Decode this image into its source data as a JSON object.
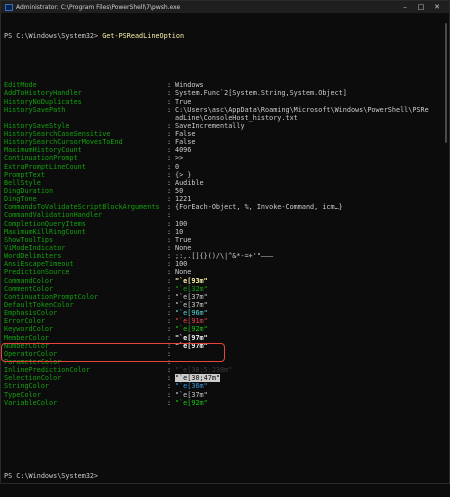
{
  "window": {
    "title": "Administrator: C:\\Program Files\\PowerShell\\7\\pwsh.exe",
    "controls": [
      "–",
      "□",
      "✕"
    ]
  },
  "console": {
    "prompt1": "PS C:\\Windows\\System32> ",
    "command": "Get-PSReadLineOption",
    "prompt2": "PS C:\\Windows\\System32>",
    "groups": [
      [
        {
          "key": "EditMode",
          "value": "Windows",
          "color": "#cccccc"
        },
        {
          "key": "AddToHistoryHandler",
          "value": "System.Func`2[System.String,System.Object]",
          "color": "#cccccc"
        },
        {
          "key": "HistoryNoDuplicates",
          "value": "True",
          "color": "#cccccc"
        },
        {
          "key": "HistorySavePath",
          "value": "C:\\Users\\asc\\AppData\\Roaming\\Microsoft\\Windows\\PowerShell\\PSRe",
          "color": "#cccccc"
        },
        {
          "key": "",
          "value": "adLine\\ConsoleHost_history.txt",
          "color": "#cccccc",
          "cont": true
        },
        {
          "key": "HistorySaveStyle",
          "value": "SaveIncrementally",
          "color": "#cccccc"
        },
        {
          "key": "HistorySearchCaseSensitive",
          "value": "False",
          "color": "#cccccc"
        },
        {
          "key": "HistorySearchCursorMovesToEnd",
          "value": "False",
          "color": "#cccccc"
        },
        {
          "key": "MaximumHistoryCount",
          "value": "4096",
          "color": "#cccccc"
        },
        {
          "key": "ContinuationPrompt",
          "value": ">>",
          "color": "#cccccc"
        },
        {
          "key": "ExtraPromptLineCount",
          "value": "0",
          "color": "#cccccc"
        },
        {
          "key": "PromptText",
          "value": "{> }",
          "color": "#cccccc"
        },
        {
          "key": "BellStyle",
          "value": "Audible",
          "color": "#cccccc"
        },
        {
          "key": "DingDuration",
          "value": "50",
          "color": "#cccccc"
        },
        {
          "key": "DingTone",
          "value": "1221",
          "color": "#cccccc"
        },
        {
          "key": "CommandsToValidateScriptBlockArguments",
          "value": "{ForEach-Object, %, Invoke-Command, icm…}",
          "color": "#cccccc"
        },
        {
          "key": "CommandValidationHandler",
          "value": "",
          "color": "#cccccc"
        },
        {
          "key": "CompletionQueryItems",
          "value": "100",
          "color": "#cccccc"
        },
        {
          "key": "MaximumKillRingCount",
          "value": "10",
          "color": "#cccccc"
        },
        {
          "key": "ShowToolTips",
          "value": "True",
          "color": "#cccccc"
        },
        {
          "key": "ViModeIndicator",
          "value": "None",
          "color": "#cccccc"
        },
        {
          "key": "WordDelimiters",
          "value": ";:,.[]{}()/\\|^&*-=+'\"–—―",
          "color": "#cccccc"
        },
        {
          "key": "AnsiEscapeTimeout",
          "value": "100",
          "color": "#cccccc"
        },
        {
          "key": "PredictionSource",
          "value": "None",
          "color": "#cccccc"
        },
        {
          "key": "CommandColor",
          "value": "\"`e[93m\"",
          "color": "#f9f1a5",
          "bold": true
        },
        {
          "key": "CommentColor",
          "value": "\"`e[32m\"",
          "color": "#13a10e"
        },
        {
          "key": "ContinuationPromptColor",
          "value": "\"`e[37m\"",
          "color": "#cccccc"
        },
        {
          "key": "DefaultTokenColor",
          "value": "\"`e[37m\"",
          "color": "#cccccc"
        },
        {
          "key": "EmphasisColor",
          "value": "\"`e[96m\"",
          "color": "#61d6d6"
        },
        {
          "key": "ErrorColor",
          "value": "\"`e[91m\"",
          "color": "#e74856"
        },
        {
          "key": "KeywordColor",
          "value": "\"`e[92m\"",
          "color": "#16c60c"
        },
        {
          "key": "MemberColor",
          "value": "\"`e[97m\"",
          "color": "#f2f2f2",
          "bold": true
        },
        {
          "key": "NumberColor",
          "value": "\"`e[97m\"",
          "color": "#f2f2f2",
          "bold": true
        },
        {
          "key": "OperatorColor",
          "value": "",
          "color": "#cccccc"
        },
        {
          "key": "ParameterColor",
          "value": "",
          "color": "#cccccc"
        },
        {
          "key": "InlinePredictionColor",
          "value": "\"`e[38;5;238m\"",
          "color": "#3a3a3a"
        },
        {
          "key": "SelectionColor",
          "value": "\"`e[30;47m\"",
          "color": "#0c0c0c",
          "bg": "#cccccc"
        },
        {
          "key": "StringColor",
          "value": "\"`e[36m\"",
          "color": "#3a96dd"
        },
        {
          "key": "TypeColor",
          "value": "\"`e[37m\"",
          "color": "#cccccc"
        },
        {
          "key": "VariableColor",
          "value": "\"`e[92m\"",
          "color": "#16c60c"
        }
      ]
    ]
  },
  "colors": {
    "background": "#0c0c0c",
    "property": "#13a10e",
    "command": "#f9f1a5",
    "highlight": "#e8443a"
  }
}
